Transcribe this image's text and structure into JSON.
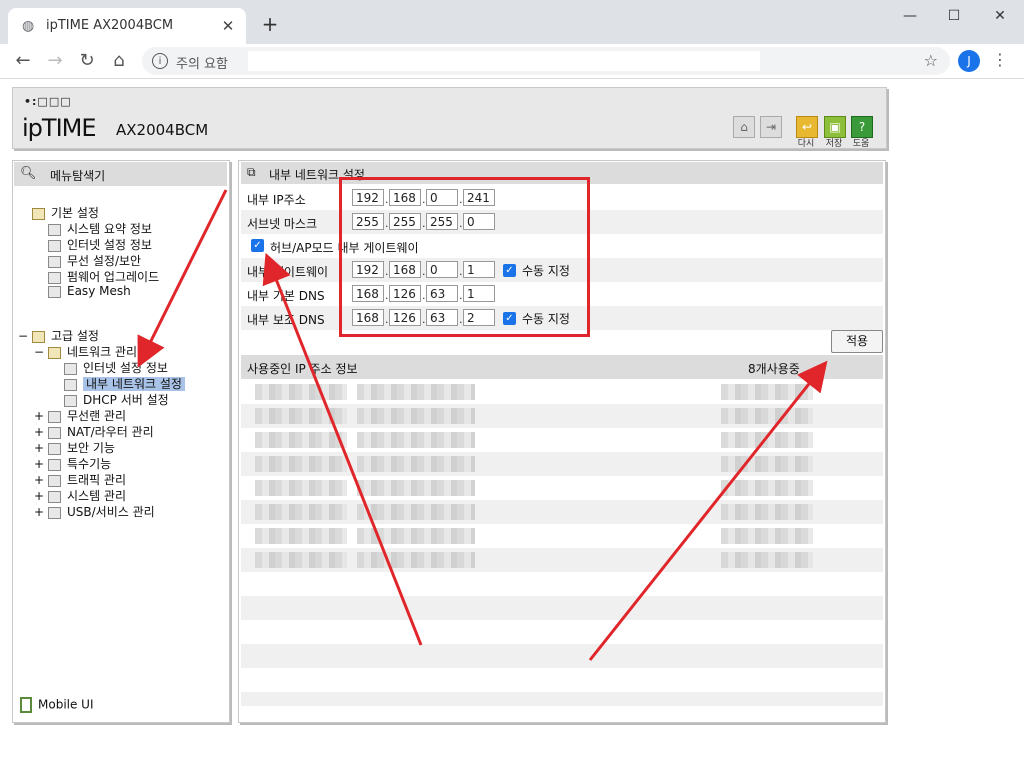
{
  "browser": {
    "tab_title": "ipTIME AX2004BCM",
    "security_label": "주의 요함",
    "avatar_letter": "J"
  },
  "header": {
    "logo_dots": "•:□□□",
    "logo": "ipTIME",
    "model": "AX2004BCM",
    "buttons": {
      "restart": "다시",
      "save": "저장",
      "help": "도움"
    }
  },
  "left": {
    "title": "메뉴탐색기",
    "basic": {
      "label": "기본 설정",
      "items": [
        "시스템 요약 정보",
        "인터넷 설정 정보",
        "무선 설정/보안",
        "펌웨어 업그레이드",
        "Easy Mesh"
      ]
    },
    "advanced": {
      "expander": "−",
      "label": "고급 설정",
      "network": {
        "expander": "−",
        "label": "네트워크 관리",
        "items": [
          "인터넷 설정 정보",
          "내부 네트워크 설정",
          "DHCP 서버 설정"
        ]
      },
      "others": [
        "무선랜 관리",
        "NAT/라우터 관리",
        "보안 기능",
        "특수기능",
        "트래픽 관리",
        "시스템 관리",
        "USB/서비스 관리"
      ],
      "other_expander": "+"
    },
    "mobile": "Mobile UI"
  },
  "main": {
    "title": "내부 네트워크 설정",
    "ip_label": "내부 IP주소",
    "ip": [
      "192",
      "168",
      "0",
      "241"
    ],
    "subnet_label": "서브넷 마스크",
    "subnet": [
      "255",
      "255",
      "255",
      "0"
    ],
    "hub_checkbox_label": "허브/AP모드 내부 게이트웨이",
    "gateway_label": "내부 게이트웨이",
    "gateway": [
      "192",
      "168",
      "0",
      "1"
    ],
    "dns1_label": "내부 기본 DNS",
    "dns1": [
      "168",
      "126",
      "63",
      "1"
    ],
    "dns2_label": "내부 보조 DNS",
    "dns2": [
      "168",
      "126",
      "63",
      "2"
    ],
    "manual_label": "수동 지정",
    "apply_label": "적용",
    "used_title": "사용중인 IP 주소 정보",
    "used_count": "8개사용중"
  },
  "annotation_color": "#e0262a"
}
